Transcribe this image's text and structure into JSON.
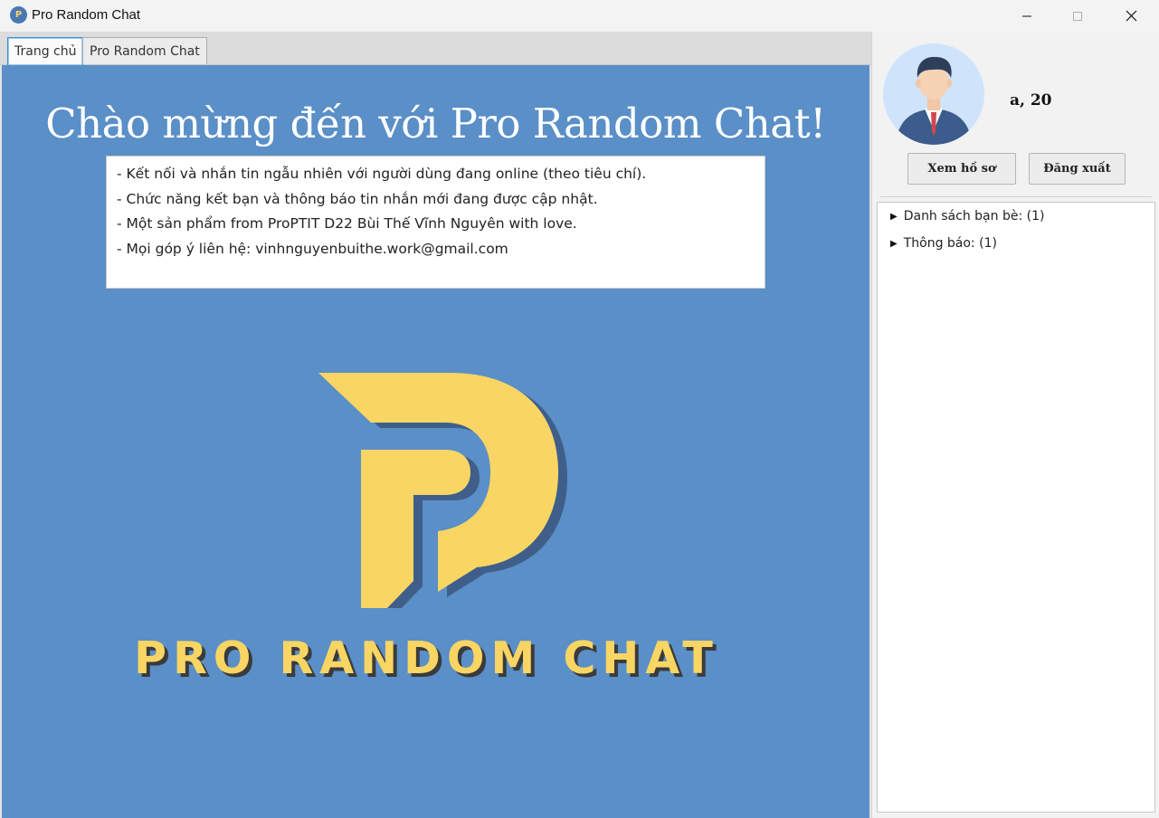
{
  "window": {
    "title": "Pro Random Chat",
    "icon_letter": "P"
  },
  "tabs": [
    {
      "label": "Trang chủ",
      "active": true
    },
    {
      "label": "Pro Random Chat",
      "active": false
    }
  ],
  "home": {
    "title": "Chào mừng đến với Pro Random Chat!",
    "info_lines": [
      "- Kết nối và nhắn tin ngẫu nhiên với người dùng đang online (theo tiêu chí).",
      "- Chức năng kết bạn và thông báo tin nhắn mới đang được cập nhật.",
      "- Một sản phẩm from ProPTIT D22 Bùi Thế Vĩnh Nguyên with love.",
      "- Mọi góp ý liên hệ: vinhnguyenbuithe.work@gmail.com"
    ],
    "brand_text": "PRO RANDOM CHAT"
  },
  "profile": {
    "name_age": "a, 20",
    "view_profile_label": "Xem hồ sơ",
    "logout_label": "Đăng xuất"
  },
  "tree": [
    {
      "label": "Danh sách bạn bè: (1)",
      "expanded": false
    },
    {
      "label": "Thông báo: (1)",
      "expanded": false
    }
  ],
  "colors": {
    "home_background": "#5a8fc8",
    "logo_yellow": "#f9d563",
    "logo_shadow": "#3f5f8a",
    "brand_shadow": "#3b3b3b"
  },
  "icons": {
    "app": "app-logo-icon",
    "minimize": "minimize-icon",
    "maximize": "maximize-icon",
    "close": "close-icon",
    "avatar": "user-avatar-icon",
    "tree_arrow": "triangle-right-icon"
  }
}
